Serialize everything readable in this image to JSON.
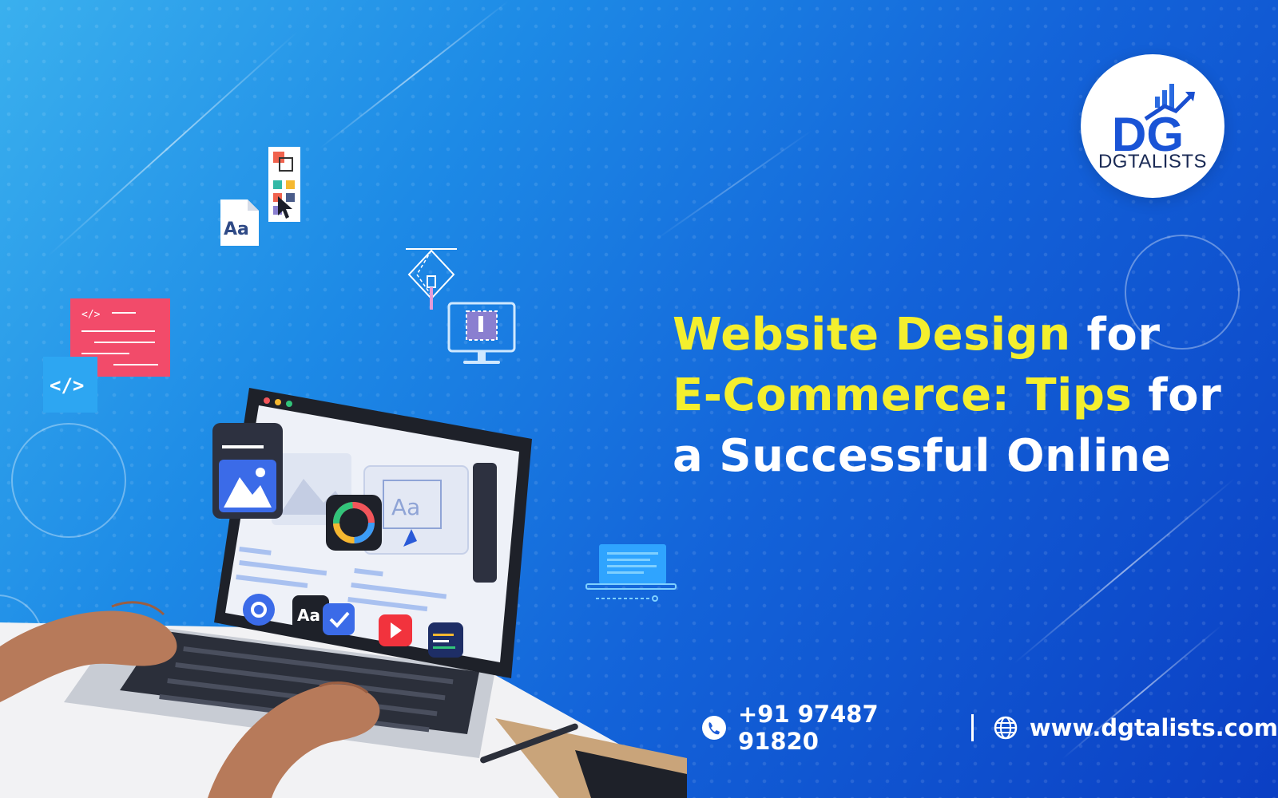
{
  "brand": {
    "logo_letters": "DG",
    "name": "DGTALISTS",
    "colors": {
      "primary": "#1e5ad6",
      "dark": "#1a2a55",
      "highlight": "#f4ef2e"
    }
  },
  "headline": {
    "line1_highlight": "Website Design",
    "line1_rest": " for",
    "line2_highlight": "E-Commerce: Tips",
    "line2_rest": " for",
    "line3": "a Successful Online"
  },
  "contact": {
    "phone_icon": "phone-icon",
    "phone": "+91 97487 91820",
    "web_icon": "globe-icon",
    "website": "www.dgtalists.com"
  },
  "illustration": {
    "font_card_text": "Aa",
    "code_tag_text": "</>",
    "code_doc_text": "</>",
    "screen_font_text": "Aa",
    "dock_font_text": "Aa",
    "icons": [
      "font-icon",
      "color-palette-icon",
      "code-icon",
      "pen-tool-icon",
      "monitor-icon",
      "image-icon",
      "color-wheel-icon",
      "gear-icon",
      "check-icon",
      "play-icon",
      "code-window-icon",
      "laptop-icon"
    ]
  }
}
